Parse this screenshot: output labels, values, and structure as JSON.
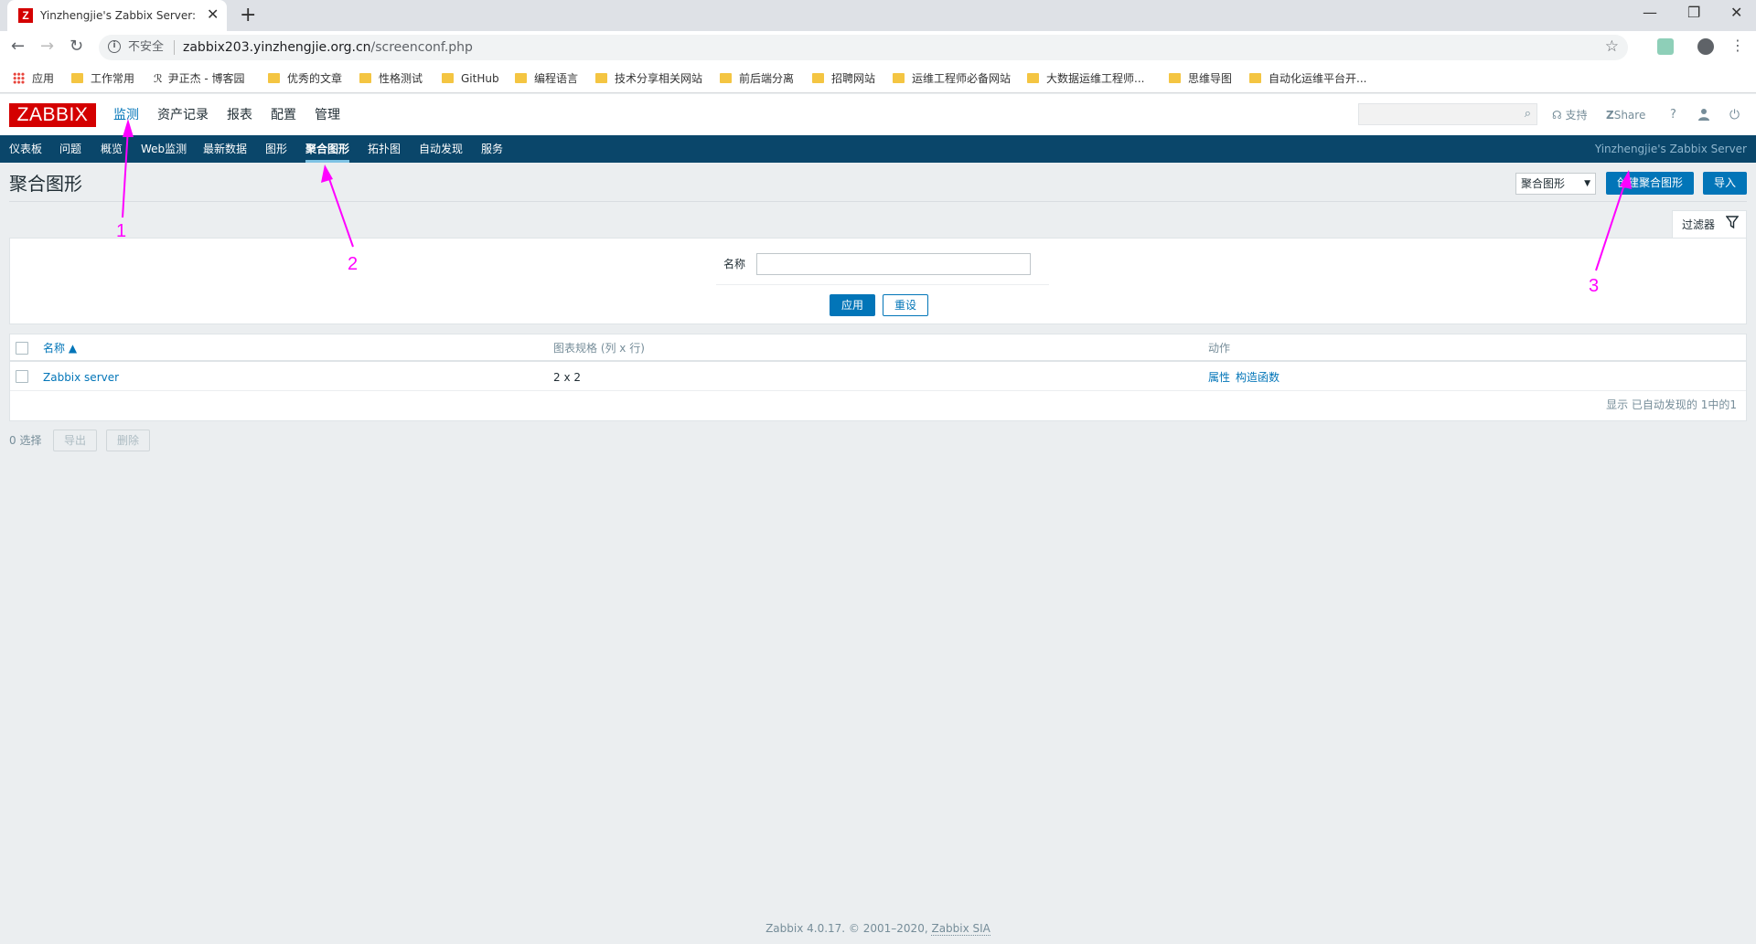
{
  "browser": {
    "tab_title": "Yinzhengjie's Zabbix Server: 聚合图形",
    "new_tab": "+",
    "insecure_label": "不安全",
    "url_host": "zabbix203.yinzhengjie.org.cn",
    "url_path": "/screenconf.php",
    "bookmarks": [
      "应用",
      "工作常用",
      "尹正杰 - 博客园",
      "优秀的文章",
      "性格测试",
      "GitHub",
      "编程语言",
      "技术分享相关网站",
      "前后端分离",
      "招聘网站",
      "运维工程师必备网站",
      "大数据运维工程师...",
      "思维导图",
      "自动化运维平台开..."
    ]
  },
  "header": {
    "logo": "ZABBIX",
    "menu": [
      "监测",
      "资产记录",
      "报表",
      "配置",
      "管理"
    ],
    "support": "支持",
    "share": "Share",
    "help": "?"
  },
  "submenu": {
    "items": [
      "仪表板",
      "问题",
      "概览",
      "Web监测",
      "最新数据",
      "图形",
      "聚合图形",
      "拓扑图",
      "自动发现",
      "服务"
    ],
    "server_name": "Yinzhengjie's Zabbix Server"
  },
  "page": {
    "title": "聚合图形",
    "view_select": "聚合图形",
    "create_button": "创建聚合图形",
    "import_button": "导入"
  },
  "filter": {
    "tab_label": "过滤器",
    "name_label": "名称",
    "name_value": "",
    "apply": "应用",
    "reset": "重设"
  },
  "table": {
    "columns": [
      "名称 ▲",
      "图表规格 (列 x 行)",
      "动作"
    ],
    "rows": [
      {
        "name": "Zabbix server",
        "dimension": "2 x 2",
        "action_props": "属性",
        "action_constructor": "构造函数"
      }
    ],
    "footer": "显示 已自动发现的 1中的1"
  },
  "actions": {
    "selected": "0 选择",
    "export": "导出",
    "delete": "删除"
  },
  "footer": {
    "text": "Zabbix 4.0.17. © 2001–2020, ",
    "link": "Zabbix SIA"
  },
  "annotations": {
    "color": "#ff00ff",
    "labels": [
      "1",
      "2",
      "3"
    ]
  }
}
